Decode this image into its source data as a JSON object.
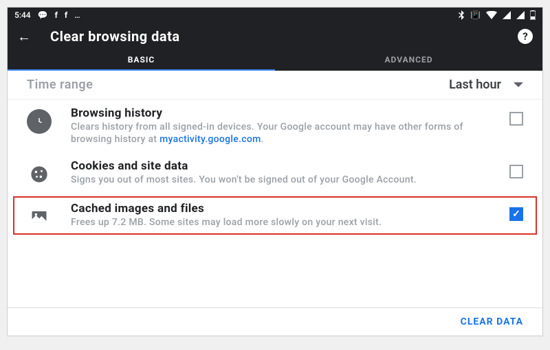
{
  "statusbar": {
    "time": "5:44"
  },
  "header": {
    "title": "Clear browsing data"
  },
  "tabs": {
    "basic": "BASIC",
    "advanced": "ADVANCED",
    "active": "basic"
  },
  "timerange": {
    "label": "Time range",
    "value": "Last hour"
  },
  "items": [
    {
      "key": "history",
      "title": "Browsing history",
      "desc_pre": "Clears history from all signed-in devices. Your Google account may have other forms of browsing history at ",
      "link_text": "myactivity.google.com",
      "desc_post": ".",
      "checked": false,
      "highlight": false
    },
    {
      "key": "cookies",
      "title": "Cookies and site data",
      "desc_pre": "Signs you out of most sites. You won't be signed out of your Google Account.",
      "link_text": "",
      "desc_post": "",
      "checked": false,
      "highlight": false
    },
    {
      "key": "cache",
      "title": "Cached images and files",
      "desc_pre": "Frees up 7.2 MB. Some sites may load more slowly on your next visit.",
      "link_text": "",
      "desc_post": "",
      "checked": true,
      "highlight": true
    }
  ],
  "footer": {
    "action": "CLEAR DATA"
  },
  "colors": {
    "accent": "#1a73e8",
    "highlight": "#d93025"
  }
}
